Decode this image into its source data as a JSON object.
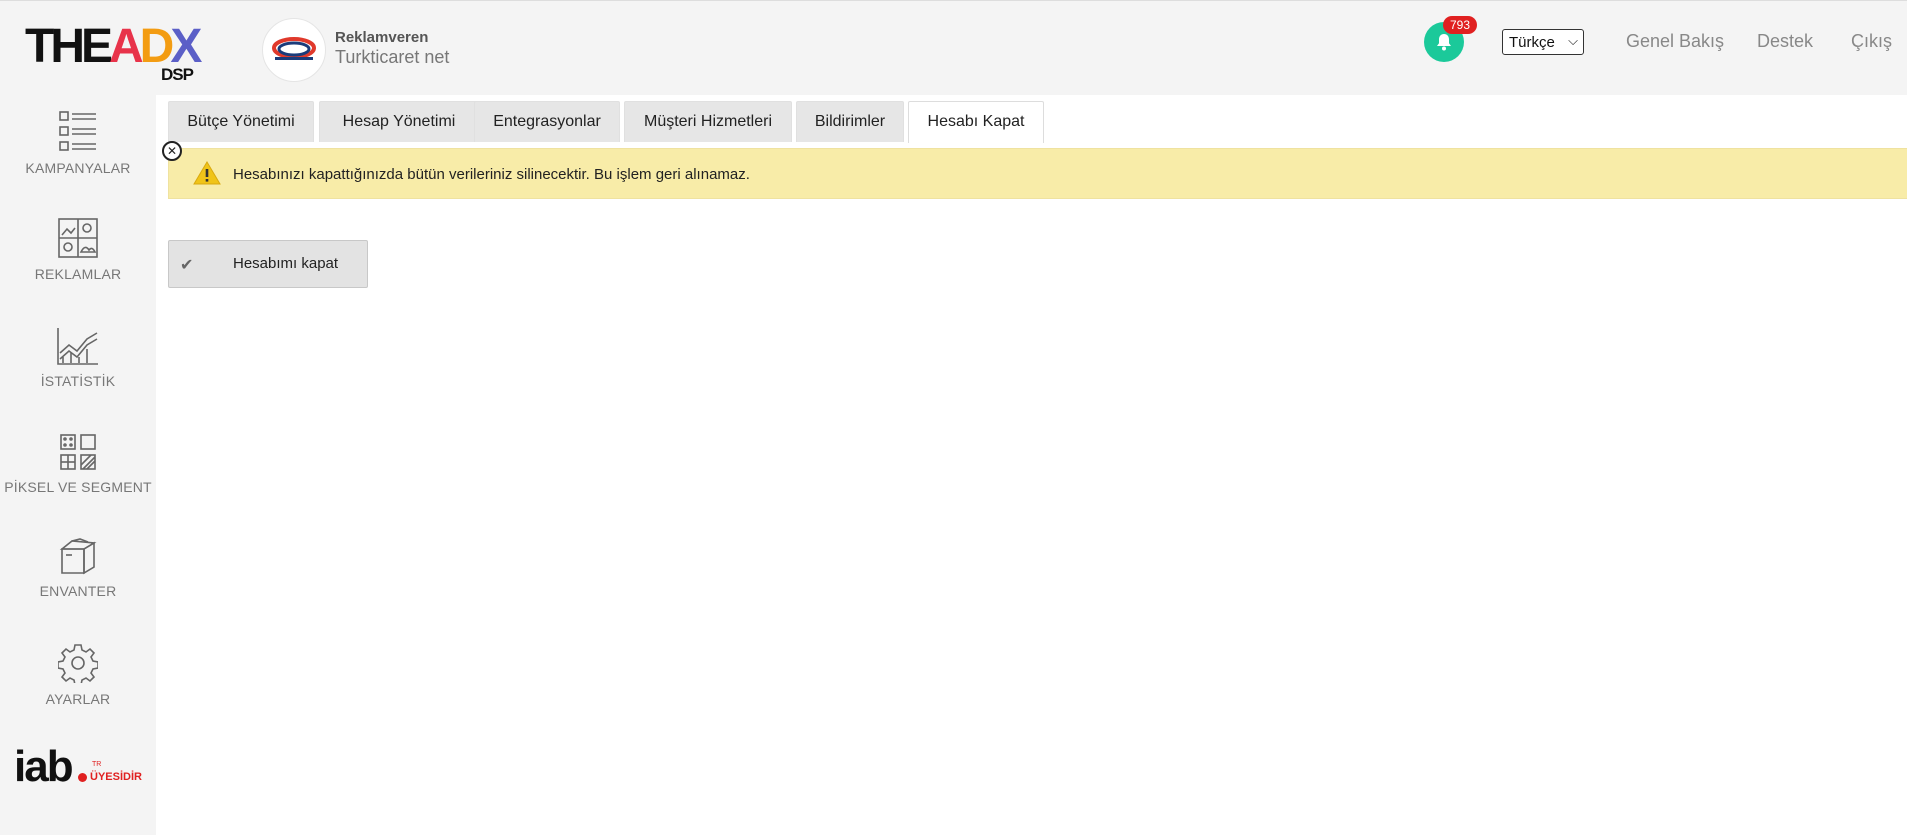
{
  "brand": {
    "logo_text": "THEADX",
    "logo_sub": "DSP"
  },
  "advertiser": {
    "role": "Reklamveren",
    "name": "Turkticaret net"
  },
  "header": {
    "notification_count": "793",
    "language": "Türkçe",
    "links": [
      "Genel Bakış",
      "Destek",
      "Çıkış"
    ]
  },
  "sidebar": {
    "items": [
      {
        "label": "KAMPANYALAR",
        "icon": "campaign-list-icon"
      },
      {
        "label": "REKLAMLAR",
        "icon": "ads-gallery-icon"
      },
      {
        "label": "İSTATİSTİK",
        "icon": "statistics-chart-icon"
      },
      {
        "label": "PİKSEL VE SEGMENT",
        "icon": "pixel-segment-icon"
      },
      {
        "label": "ENVANTER",
        "icon": "inventory-box-icon"
      },
      {
        "label": "AYARLAR",
        "icon": "settings-gear-icon"
      }
    ],
    "iab": {
      "big": "iab",
      "tr": "TR",
      "small": "ÜYESİDİR"
    }
  },
  "tabs": [
    {
      "label": "Bütçe Yönetimi",
      "active": false
    },
    {
      "label": "Hesap Yönetimi",
      "active": false
    },
    {
      "label": "Entegrasyonlar",
      "active": false
    },
    {
      "label": "Müşteri Hizmetleri",
      "active": false
    },
    {
      "label": "Bildirimler",
      "active": false
    },
    {
      "label": "Hesabı Kapat",
      "active": true
    }
  ],
  "alert": {
    "message": "Hesabınızı kapattığınızda bütün verileriniz silinecektir. Bu işlem geri alınamaz."
  },
  "actions": {
    "close_account_label": "Hesabımı kapat"
  },
  "colors": {
    "accent": "#1bc99a",
    "badge": "#e02020",
    "alert_bg": "#f8eca8",
    "sidebar_bg": "#f4f4f4"
  }
}
